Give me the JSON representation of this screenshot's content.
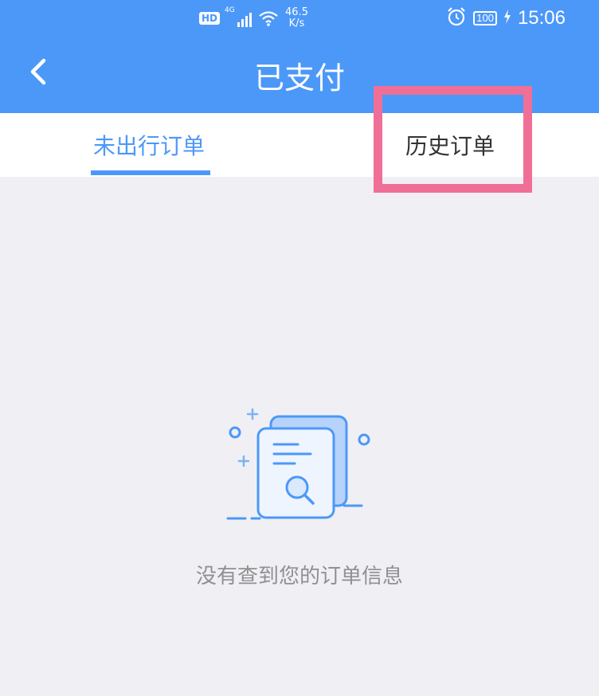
{
  "status_bar": {
    "hd": "HD",
    "network": "4G",
    "speed_value": "46.5",
    "speed_unit": "K/s",
    "battery": "100",
    "time": "15:06"
  },
  "header": {
    "title": "已支付"
  },
  "tabs": [
    {
      "label": "未出行订单",
      "active": true
    },
    {
      "label": "历史订单",
      "active": false
    }
  ],
  "empty_state": {
    "message": "没有查到您的订单信息"
  },
  "colors": {
    "primary": "#4c98f8",
    "background": "#f0eff4",
    "highlight": "#ef6f97"
  }
}
